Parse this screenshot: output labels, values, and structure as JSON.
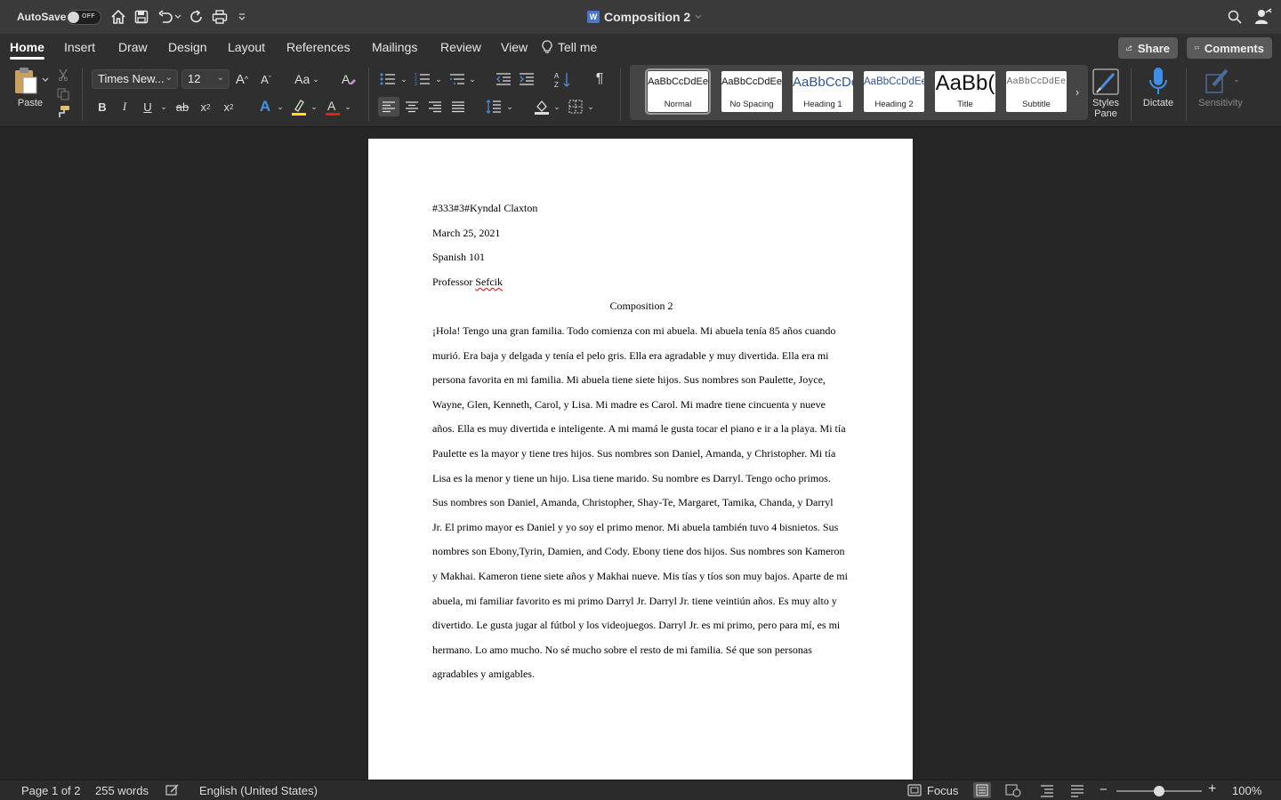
{
  "titlebar": {
    "autosave_label": "AutoSave",
    "autosave_state": "OFF",
    "doc_title": "Composition 2",
    "icons": [
      "home-icon",
      "save-icon",
      "undo-icon",
      "redo-icon",
      "print-icon",
      "customize-icon",
      "search-icon",
      "account-icon"
    ]
  },
  "tabs": [
    "Home",
    "Insert",
    "Draw",
    "Design",
    "Layout",
    "References",
    "Mailings",
    "Review",
    "View"
  ],
  "tell_me": "Tell me",
  "share_label": "Share",
  "comments_label": "Comments",
  "ribbon": {
    "paste_label": "Paste",
    "font_name": "Times New...",
    "font_size": "12",
    "styles": [
      {
        "preview": "AaBbCcDdEe",
        "name": "Normal"
      },
      {
        "preview": "AaBbCcDdEe",
        "name": "No Spacing"
      },
      {
        "preview": "AaBbCcDc",
        "name": "Heading 1"
      },
      {
        "preview": "AaBbCcDdEe",
        "name": "Heading 2"
      },
      {
        "preview": "AaBb(",
        "name": "Title"
      },
      {
        "preview": "AaBbCcDdEe",
        "name": "Subtitle"
      }
    ],
    "styles_pane_label": "Styles Pane",
    "dictate_label": "Dictate",
    "sensitivity_label": "Sensitivity",
    "accent_highlight": "#ffe500",
    "accent_font_color": "#e02020"
  },
  "document": {
    "header_lines": [
      "#333#3#Kyndal Claxton",
      "March 25, 2021",
      "Spanish 101",
      "Professor Sefcik"
    ],
    "title": "Composition 2",
    "body_lines": [
      "¡Hola! Tengo una gran familia. Todo comienza con mi abuela. Mi abuela tenía 85 años cuando",
      "murió. Era baja y delgada y tenía el pelo gris. Ella era agradable y muy divertida. Ella era mi",
      "persona favorita en mi familia. Mi abuela tiene siete hijos. Sus nombres son Paulette, Joyce,",
      "Wayne, Glen, Kenneth, Carol, y Lisa. Mi madre es Carol. Mi madre tiene cincuenta y nueve",
      "años. Ella es muy divertida e inteligente. A mi mamá le gusta tocar el piano e ir a la playa. Mi tía",
      "Paulette es la mayor y tiene tres hijos. Sus nombres son Daniel, Amanda, y Christopher. Mi tía",
      "Lisa es la menor y tiene un hijo. Lisa tiene marido. Su nombre es Darryl. Tengo ocho primos.",
      "Sus nombres son Daniel, Amanda, Christopher, Shay-Te, Margaret, Tamika, Chanda, y Darryl",
      "Jr. El primo mayor es Daniel y yo soy el primo menor. Mi abuela también tuvo 4 bisnietos. Sus",
      "nombres son Ebony,Tyrin, Damien, and Cody. Ebony tiene dos hijos. Sus nombres son Kameron",
      "y Makhai. Kameron tiene siete años y Makhai nueve. Mis tías y tíos son muy bajos. Aparte de mi",
      "abuela, mi familiar favorito es mi primo Darryl Jr. Darryl Jr. tiene veintiún años. Es muy alto y",
      "divertido. Le gusta jugar al fútbol y los videojuegos. Darryl Jr. es mi primo, pero para mí, es mi",
      "hermano. Lo amo mucho. No sé mucho sobre el resto de mi familia. Sé que son personas",
      "agradables y amigables."
    ]
  },
  "status": {
    "page": "Page 1 of 2",
    "words": "255 words",
    "language": "English (United States)",
    "focus": "Focus",
    "zoom": "100%",
    "zoom_level": 1.0
  }
}
